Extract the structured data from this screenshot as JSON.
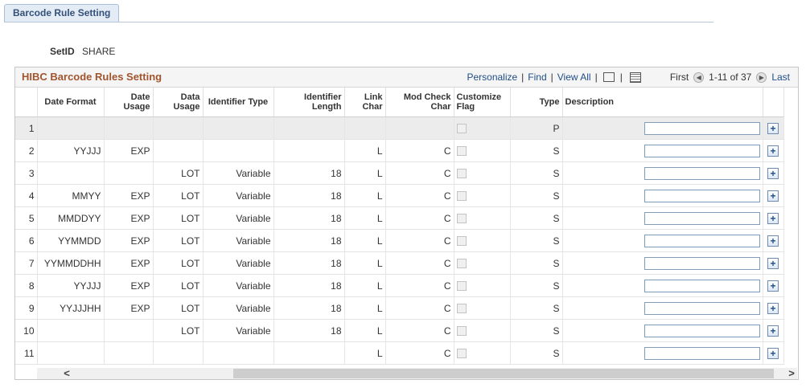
{
  "tab": {
    "label": "Barcode Rule Setting"
  },
  "setid": {
    "label": "SetID",
    "value": "SHARE"
  },
  "grid": {
    "title": "HIBC Barcode Rules Setting",
    "nav": {
      "personalize": "Personalize",
      "find": "Find",
      "view_all": "View All",
      "first": "First",
      "range": "1-11 of 37",
      "last": "Last"
    },
    "columns": [
      {
        "key": "num",
        "label": ""
      },
      {
        "key": "date_format",
        "label": "Date Format"
      },
      {
        "key": "date_usage",
        "label": "Date Usage"
      },
      {
        "key": "data_usage",
        "label": "Data Usage"
      },
      {
        "key": "identifier_type",
        "label": "Identifier Type"
      },
      {
        "key": "identifier_length",
        "label": "Identifier Length"
      },
      {
        "key": "link_char",
        "label": "Link Char"
      },
      {
        "key": "mod_check_char",
        "label": "Mod Check Char"
      },
      {
        "key": "customize_flag",
        "label": "Customize Flag"
      },
      {
        "key": "type",
        "label": "Type"
      },
      {
        "key": "description",
        "label": "Description"
      },
      {
        "key": "add",
        "label": ""
      }
    ],
    "rows": [
      {
        "num": "1",
        "date_format": "",
        "date_usage": "",
        "data_usage": "",
        "identifier_type": "",
        "identifier_length": "",
        "link_char": "",
        "mod_check_char": "",
        "type": "P",
        "description": ""
      },
      {
        "num": "2",
        "date_format": "YYJJJ",
        "date_usage": "EXP",
        "data_usage": "",
        "identifier_type": "",
        "identifier_length": "",
        "link_char": "L",
        "mod_check_char": "C",
        "type": "S",
        "description": ""
      },
      {
        "num": "3",
        "date_format": "",
        "date_usage": "",
        "data_usage": "LOT",
        "identifier_type": "Variable",
        "identifier_length": "18",
        "link_char": "L",
        "mod_check_char": "C",
        "type": "S",
        "description": ""
      },
      {
        "num": "4",
        "date_format": "MMYY",
        "date_usage": "EXP",
        "data_usage": "LOT",
        "identifier_type": "Variable",
        "identifier_length": "18",
        "link_char": "L",
        "mod_check_char": "C",
        "type": "S",
        "description": ""
      },
      {
        "num": "5",
        "date_format": "MMDDYY",
        "date_usage": "EXP",
        "data_usage": "LOT",
        "identifier_type": "Variable",
        "identifier_length": "18",
        "link_char": "L",
        "mod_check_char": "C",
        "type": "S",
        "description": ""
      },
      {
        "num": "6",
        "date_format": "YYMMDD",
        "date_usage": "EXP",
        "data_usage": "LOT",
        "identifier_type": "Variable",
        "identifier_length": "18",
        "link_char": "L",
        "mod_check_char": "C",
        "type": "S",
        "description": ""
      },
      {
        "num": "7",
        "date_format": "YYMMDDHH",
        "date_usage": "EXP",
        "data_usage": "LOT",
        "identifier_type": "Variable",
        "identifier_length": "18",
        "link_char": "L",
        "mod_check_char": "C",
        "type": "S",
        "description": ""
      },
      {
        "num": "8",
        "date_format": "YYJJJ",
        "date_usage": "EXP",
        "data_usage": "LOT",
        "identifier_type": "Variable",
        "identifier_length": "18",
        "link_char": "L",
        "mod_check_char": "C",
        "type": "S",
        "description": ""
      },
      {
        "num": "9",
        "date_format": "YYJJJHH",
        "date_usage": "EXP",
        "data_usage": "LOT",
        "identifier_type": "Variable",
        "identifier_length": "18",
        "link_char": "L",
        "mod_check_char": "C",
        "type": "S",
        "description": ""
      },
      {
        "num": "10",
        "date_format": "",
        "date_usage": "",
        "data_usage": "LOT",
        "identifier_type": "Variable",
        "identifier_length": "18",
        "link_char": "L",
        "mod_check_char": "C",
        "type": "S",
        "description": ""
      },
      {
        "num": "11",
        "date_format": "",
        "date_usage": "",
        "data_usage": "",
        "identifier_type": "",
        "identifier_length": "",
        "link_char": "L",
        "mod_check_char": "C",
        "type": "S",
        "description": ""
      }
    ],
    "add_glyph": "+",
    "scroll": {
      "left_glyph": "<",
      "right_glyph": ">"
    }
  },
  "colors": {
    "title": "#a0552f",
    "link": "#1f4d86"
  }
}
